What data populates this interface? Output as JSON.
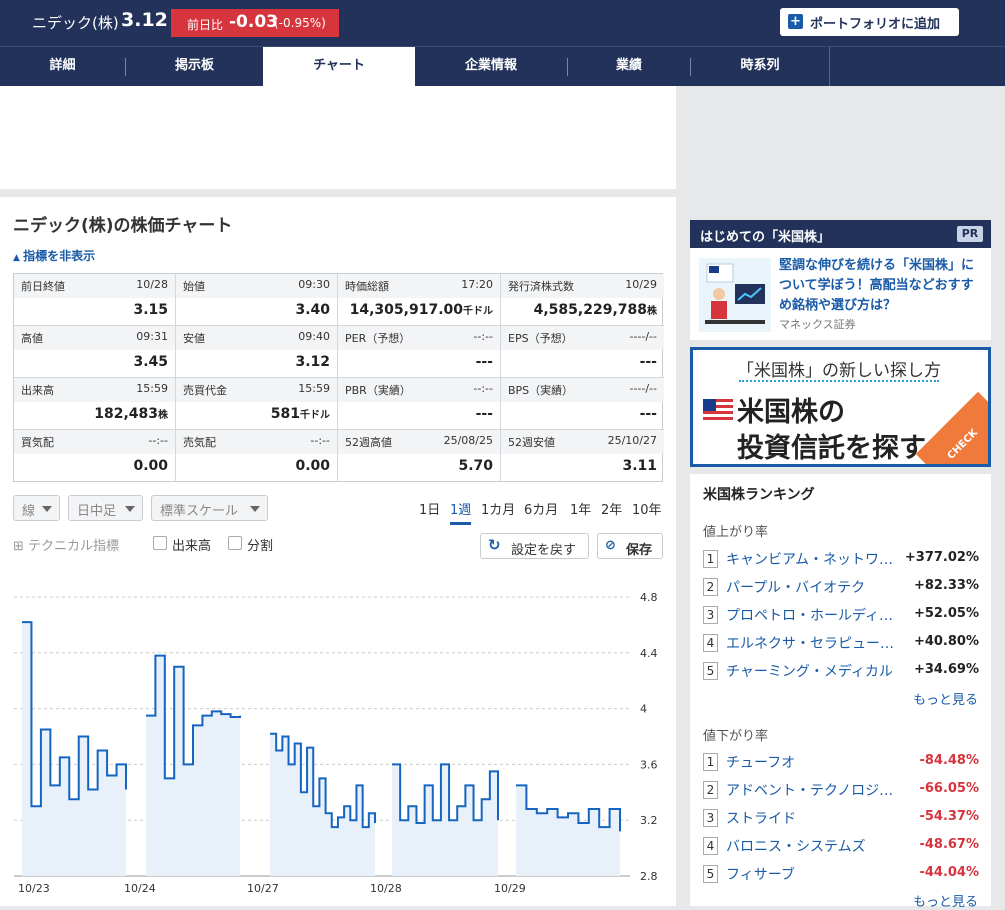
{
  "header": {
    "stock_name": "ニデック(株)",
    "price": "3.12",
    "change_label": "前日比",
    "change": "-0.03",
    "change_pct": "(-0.95%)",
    "portfolio_button": "ポートフォリオに追加"
  },
  "tabs": [
    "詳細",
    "掲示板",
    "チャート",
    "企業情報",
    "業績",
    "時系列"
  ],
  "active_tab": "チャート",
  "chart_section": {
    "title": "ニデック(株)の株価チャート",
    "toggle_indicators": "指標を非表示"
  },
  "stats": [
    {
      "label": "前日終値",
      "time": "10/28",
      "value": "3.15",
      "unit": ""
    },
    {
      "label": "始値",
      "time": "09:30",
      "value": "3.40",
      "unit": ""
    },
    {
      "label": "時価総額",
      "time": "17:20",
      "value": "14,305,917.00",
      "unit": "千ドル"
    },
    {
      "label": "発行済株式数",
      "time": "10/29",
      "value": "4,585,229,788",
      "unit": "株"
    },
    {
      "label": "高値",
      "time": "09:31",
      "value": "3.45",
      "unit": ""
    },
    {
      "label": "安値",
      "time": "09:40",
      "value": "3.12",
      "unit": ""
    },
    {
      "label": "PER（予想）",
      "time": "--:--",
      "value": "---",
      "unit": ""
    },
    {
      "label": "EPS（予想）",
      "time": "----/--",
      "value": "---",
      "unit": ""
    },
    {
      "label": "出来高",
      "time": "15:59",
      "value": "182,483",
      "unit": "株"
    },
    {
      "label": "売買代金",
      "time": "15:59",
      "value": "581",
      "unit": "千ドル"
    },
    {
      "label": "PBR（実績）",
      "time": "--:--",
      "value": "---",
      "unit": ""
    },
    {
      "label": "BPS（実績）",
      "time": "----/--",
      "value": "---",
      "unit": ""
    },
    {
      "label": "買気配",
      "time": "--:--",
      "value": "0.00",
      "unit": ""
    },
    {
      "label": "売気配",
      "time": "--:--",
      "value": "0.00",
      "unit": ""
    },
    {
      "label": "52週高値",
      "time": "25/08/25",
      "value": "5.70",
      "unit": ""
    },
    {
      "label": "52週安値",
      "time": "25/10/27",
      "value": "3.11",
      "unit": ""
    }
  ],
  "controls": {
    "line_type": "線",
    "interval": "日中足",
    "scale": "標準スケール",
    "periods": [
      "1日",
      "1週",
      "1カ月",
      "6カ月",
      "1年",
      "2年",
      "10年"
    ],
    "active_period": "1週",
    "technical": "テクニカル指標",
    "volume_check": "出来高",
    "split_check": "分割",
    "reset_button": "設定を戻す",
    "save_button": "保存"
  },
  "chart_data": {
    "type": "area",
    "x_labels": [
      "10/23",
      "10/24",
      "10/27",
      "10/28",
      "10/29"
    ],
    "ylim": [
      2.8,
      4.8
    ],
    "yticks": [
      "4.8",
      "4.4",
      "4",
      "3.6",
      "3.2",
      "2.8"
    ],
    "grid": true,
    "series": [
      {
        "values": [
          4.62,
          3.3,
          3.85,
          3.45,
          3.65,
          3.35,
          3.8,
          3.42,
          3.7,
          3.52,
          3.6,
          3.42
        ]
      },
      {
        "values": [
          3.95,
          4.38,
          3.5,
          4.3,
          3.6,
          3.88,
          3.95,
          3.98,
          3.96,
          3.94,
          3.95
        ]
      },
      {
        "values": [
          3.82,
          3.7,
          3.8,
          3.6,
          3.75,
          3.4,
          3.72,
          3.3,
          3.5,
          3.25,
          3.15,
          3.22,
          3.3,
          3.2,
          3.45,
          3.15,
          3.25,
          3.18
        ]
      },
      {
        "values": [
          3.6,
          3.2,
          3.3,
          3.18,
          3.45,
          3.2,
          3.6,
          3.2,
          3.3,
          3.45,
          3.2,
          3.35,
          3.55,
          3.2
        ]
      },
      {
        "values": [
          3.45,
          3.28,
          3.25,
          3.28,
          3.22,
          3.25,
          3.18,
          3.28,
          3.15,
          3.28,
          3.12
        ]
      }
    ]
  },
  "sidebar_ad": {
    "header": "はじめての「米国株」",
    "pr": "PR",
    "text": "堅調な伸びを続ける「米国株」について学ぼう！高配当などおすすめ銘柄や選び方は？",
    "source": "マネックス証券"
  },
  "banner": {
    "line1": "「米国株」の新しい探し方",
    "line2": "米国株の",
    "line3": "投資信託を探す",
    "check": "CHECK"
  },
  "ranking": {
    "title": "米国株ランキング",
    "up_label": "値上がり率",
    "up": [
      {
        "rank": "1",
        "name": "キャンビアム・ネットワークス",
        "pct": "+377.02%"
      },
      {
        "rank": "2",
        "name": "パープル・バイオテク",
        "pct": "+82.33%"
      },
      {
        "rank": "3",
        "name": "プロペトロ・ホールディング",
        "pct": "+52.05%"
      },
      {
        "rank": "4",
        "name": "エルネクサ・セラピューティクス",
        "pct": "+40.80%"
      },
      {
        "rank": "5",
        "name": "チャーミング・メディカル",
        "pct": "+34.69%"
      }
    ],
    "down_label": "値下がり率",
    "down": [
      {
        "rank": "1",
        "name": "チューフオ",
        "pct": "-84.48%"
      },
      {
        "rank": "2",
        "name": "アドベント・テクノロジーズ",
        "pct": "-66.05%"
      },
      {
        "rank": "3",
        "name": "ストライド",
        "pct": "-54.37%"
      },
      {
        "rank": "4",
        "name": "バロニス・システムズ",
        "pct": "-48.67%"
      },
      {
        "rank": "5",
        "name": "フィサーブ",
        "pct": "-44.04%"
      }
    ],
    "more": "もっと見る"
  }
}
